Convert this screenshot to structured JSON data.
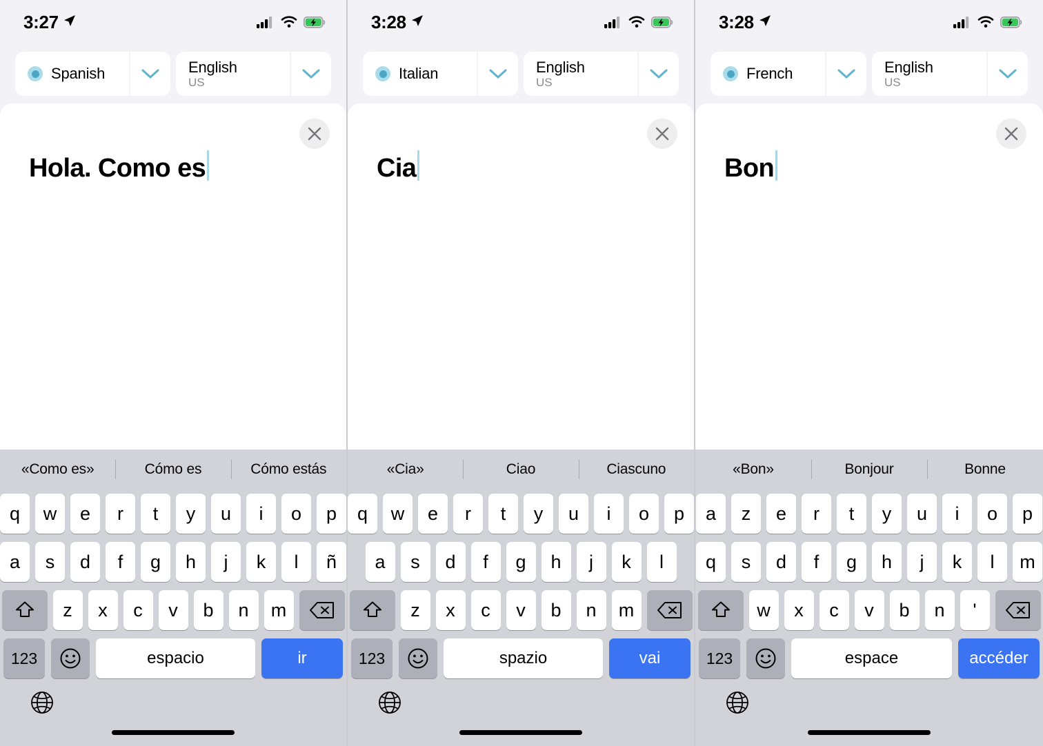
{
  "panels": [
    {
      "statusbar": {
        "time": "3:27",
        "location_icon": "location-arrow-icon",
        "signal_icon": "cellular-signal-icon",
        "wifi_icon": "wifi-icon",
        "battery_icon": "battery-charging-icon"
      },
      "source_language": {
        "name": "Spanish",
        "region": ""
      },
      "target_language": {
        "name": "English",
        "region": "US"
      },
      "clear_label": "×",
      "input_text": "Hola. Como es",
      "suggestions": [
        "«Como es»",
        "Cómo es",
        "Cómo estás"
      ],
      "keyboard": {
        "layout": "qwerty-spanish",
        "row1": [
          "q",
          "w",
          "e",
          "r",
          "t",
          "y",
          "u",
          "i",
          "o",
          "p"
        ],
        "row2": [
          "a",
          "s",
          "d",
          "f",
          "g",
          "h",
          "j",
          "k",
          "l",
          "ñ"
        ],
        "row3": [
          "z",
          "x",
          "c",
          "v",
          "b",
          "n",
          "m"
        ],
        "shift_icon": "shift-arrow-icon",
        "delete_icon": "backspace-icon",
        "numeric_label": "123",
        "emoji_icon": "emoji-smiley-icon",
        "space_label": "espacio",
        "return_label": "ir",
        "globe_icon": "globe-icon"
      }
    },
    {
      "statusbar": {
        "time": "3:28",
        "location_icon": "location-arrow-icon",
        "signal_icon": "cellular-signal-icon",
        "wifi_icon": "wifi-icon",
        "battery_icon": "battery-charging-icon"
      },
      "source_language": {
        "name": "Italian",
        "region": ""
      },
      "target_language": {
        "name": "English",
        "region": "US"
      },
      "clear_label": "×",
      "input_text": "Cia",
      "suggestions": [
        "«Cia»",
        "Ciao",
        "Ciascuno"
      ],
      "keyboard": {
        "layout": "qwerty-italian",
        "row1": [
          "q",
          "w",
          "e",
          "r",
          "t",
          "y",
          "u",
          "i",
          "o",
          "p"
        ],
        "row2": [
          "a",
          "s",
          "d",
          "f",
          "g",
          "h",
          "j",
          "k",
          "l"
        ],
        "row3": [
          "z",
          "x",
          "c",
          "v",
          "b",
          "n",
          "m"
        ],
        "shift_icon": "shift-arrow-icon",
        "delete_icon": "backspace-icon",
        "numeric_label": "123",
        "emoji_icon": "emoji-smiley-icon",
        "space_label": "spazio",
        "return_label": "vai",
        "globe_icon": "globe-icon"
      }
    },
    {
      "statusbar": {
        "time": "3:28",
        "location_icon": "location-arrow-icon",
        "signal_icon": "cellular-signal-icon",
        "wifi_icon": "wifi-icon",
        "battery_icon": "battery-charging-icon"
      },
      "source_language": {
        "name": "French",
        "region": ""
      },
      "target_language": {
        "name": "English",
        "region": "US"
      },
      "clear_label": "×",
      "input_text": "Bon",
      "suggestions": [
        "«Bon»",
        "Bonjour",
        "Bonne"
      ],
      "keyboard": {
        "layout": "azerty-french",
        "row1": [
          "a",
          "z",
          "e",
          "r",
          "t",
          "y",
          "u",
          "i",
          "o",
          "p"
        ],
        "row2": [
          "q",
          "s",
          "d",
          "f",
          "g",
          "h",
          "j",
          "k",
          "l",
          "m"
        ],
        "row3": [
          "w",
          "x",
          "c",
          "v",
          "b",
          "n",
          "'"
        ],
        "shift_icon": "shift-arrow-icon",
        "delete_icon": "backspace-icon",
        "numeric_label": "123",
        "emoji_icon": "emoji-smiley-icon",
        "space_label": "espace",
        "return_label": "accéder",
        "globe_icon": "globe-icon"
      }
    }
  ],
  "colors": {
    "accent_blue": "#3b74f2",
    "radio_teal": "#4aa7c4",
    "radio_teal_light": "#a9dbe8",
    "keyboard_bg": "#d1d3d9",
    "key_white": "#ffffff",
    "key_gray": "#adb0b8",
    "page_bg": "#f2f2f7",
    "caret": "#a8d8e8",
    "battery_green": "#38c85a"
  }
}
